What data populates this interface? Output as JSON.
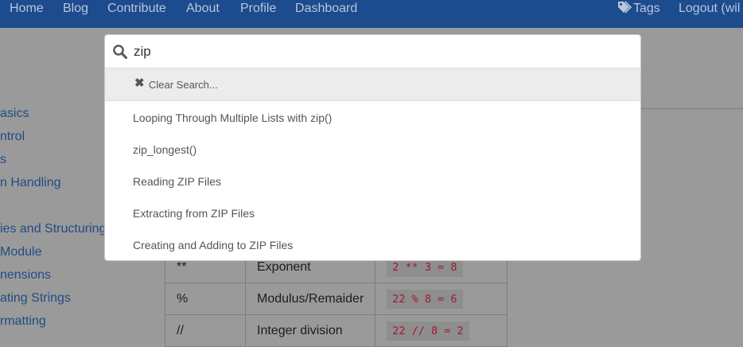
{
  "nav": {
    "home": "Home",
    "blog": "Blog",
    "contribute": "Contribute",
    "about": "About",
    "profile": "Profile",
    "dashboard": "Dashboard",
    "tags": "Tags",
    "logout": "Logout (wil"
  },
  "sidebar": {
    "items": [
      {
        "label": "asics"
      },
      {
        "label": "ntrol"
      },
      {
        "label": "s"
      },
      {
        "label": "n Handling"
      },
      {
        "label": "ies and Structuring"
      },
      {
        "label": "Module"
      },
      {
        "label": "nensions"
      },
      {
        "label": "ating Strings"
      },
      {
        "label": "rmatting"
      }
    ]
  },
  "operators_table": {
    "rows": [
      {
        "operator": "**",
        "description": "Exponent",
        "example": "2 ** 3 = 8"
      },
      {
        "operator": "%",
        "description": "Modulus/Remaider",
        "example": "22 % 8 = 6"
      },
      {
        "operator": "//",
        "description": "Integer division",
        "example": "22 // 8 = 2"
      }
    ]
  },
  "search": {
    "query": "zip",
    "clear_label": "Clear Search...",
    "clear_icon": "close-icon",
    "results": [
      {
        "title": "Looping Through Multiple Lists with zip()"
      },
      {
        "title": "zip_longest()"
      },
      {
        "title": "Reading ZIP Files"
      },
      {
        "title": "Extracting from ZIP Files"
      },
      {
        "title": "Creating and Adding to ZIP Files"
      }
    ]
  },
  "colors": {
    "navbar": "#1c4b8e",
    "overlay_background": "#9a9a9a",
    "link": "#1f4c85",
    "code_text": "#9c1d2e"
  }
}
